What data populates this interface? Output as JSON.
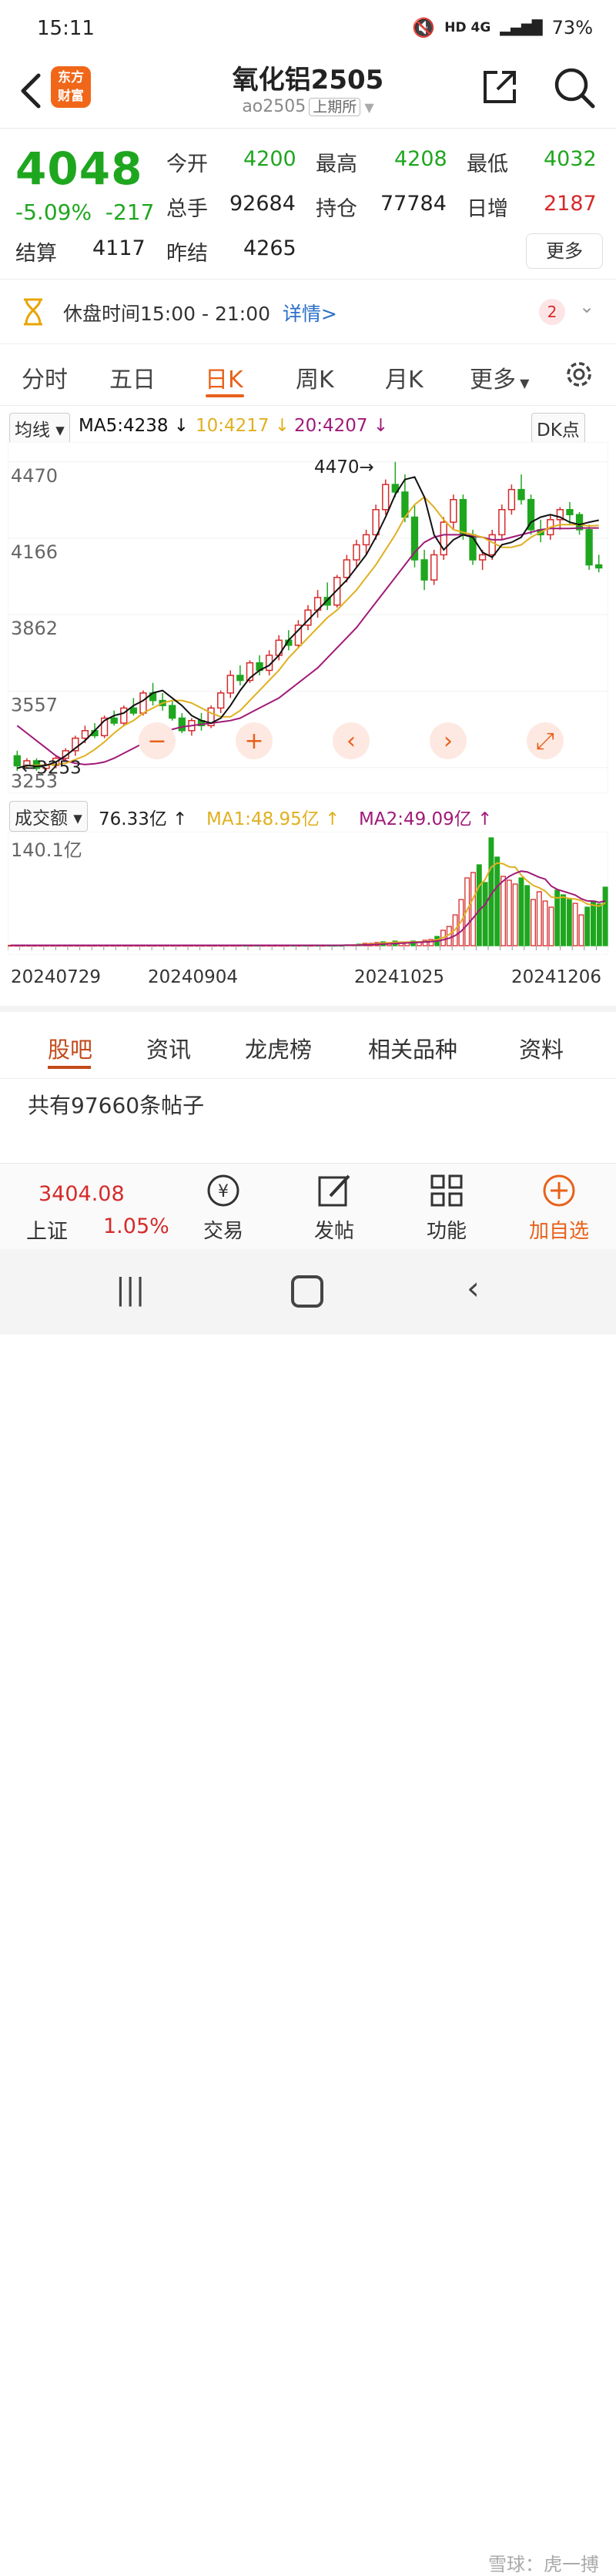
{
  "status": {
    "time": "15:11",
    "network": "HD 4G",
    "battery": "73%"
  },
  "header": {
    "logo_line1": "东方",
    "logo_line2": "财富",
    "title": "氧化铝2505",
    "code": "ao2505",
    "exchange": "上期所"
  },
  "quote": {
    "price": "4048",
    "change_pct": "-5.09%",
    "change": "-217",
    "open_label": "今开",
    "open": "4200",
    "high_label": "最高",
    "high": "4208",
    "low_label": "最低",
    "low": "4032",
    "volume_label": "总手",
    "volume": "92684",
    "oi_label": "持仓",
    "oi": "77784",
    "dayinc_label": "日增",
    "dayinc": "2187",
    "settle_label": "结算",
    "settle": "4117",
    "prev_settle_label": "昨结",
    "prev_settle": "4265",
    "more": "更多"
  },
  "notice": {
    "text": "休盘时间15:00 - 21:00",
    "detail": "详情>",
    "badge": "2"
  },
  "tabs": [
    "分时",
    "五日",
    "日K",
    "周K",
    "月K",
    "更多"
  ],
  "ma": {
    "selector": "均线",
    "ma5": "MA5:4238",
    "ma10": "10:4217",
    "ma20": "20:4207",
    "dk": "DK点"
  },
  "colors": {
    "up": "#d62a2a",
    "down": "#1fa61f",
    "accent": "#e8611a",
    "ma5": "#111111",
    "ma10": "#e0b020",
    "ma20": "#a01a78"
  },
  "chart_data": {
    "type": "candlestick",
    "y_ticks": [
      "4470",
      "4166",
      "3862",
      "3557",
      "3253"
    ],
    "ylim": [
      3200,
      4500
    ],
    "annotations": {
      "high": "4470",
      "low": "3253"
    },
    "ma5": [
      3250,
      3262,
      3258,
      3262,
      3275,
      3300,
      3330,
      3360,
      3400,
      3440,
      3460,
      3470,
      3500,
      3520,
      3550,
      3560,
      3530,
      3500,
      3460,
      3440,
      3430,
      3450,
      3500,
      3560,
      3610,
      3640,
      3660,
      3700,
      3760,
      3800,
      3840,
      3880,
      3920,
      3960,
      4000,
      4050,
      4100,
      4170,
      4250,
      4340,
      4400,
      4410,
      4330,
      4180,
      4120,
      4160,
      4180,
      4170,
      4110,
      4090,
      4140,
      4150,
      4170,
      4230,
      4250,
      4260,
      4250,
      4230,
      4220,
      4230,
      4238
    ],
    "ma10": [
      3250,
      3260,
      3262,
      3263,
      3265,
      3270,
      3285,
      3300,
      3325,
      3355,
      3390,
      3420,
      3440,
      3470,
      3490,
      3510,
      3520,
      3520,
      3510,
      3490,
      3470,
      3455,
      3455,
      3480,
      3520,
      3560,
      3600,
      3640,
      3690,
      3730,
      3770,
      3810,
      3850,
      3880,
      3920,
      3960,
      4010,
      4060,
      4120,
      4180,
      4250,
      4300,
      4330,
      4290,
      4240,
      4200,
      4190,
      4180,
      4170,
      4150,
      4130,
      4130,
      4140,
      4170,
      4190,
      4210,
      4220,
      4220,
      4220,
      4215,
      4217
    ],
    "ma20": [
      3420,
      3390,
      3360,
      3330,
      3300,
      3280,
      3270,
      3265,
      3268,
      3275,
      3290,
      3310,
      3330,
      3350,
      3370,
      3390,
      3405,
      3415,
      3420,
      3425,
      3430,
      3435,
      3440,
      3450,
      3470,
      3490,
      3510,
      3530,
      3560,
      3590,
      3620,
      3650,
      3690,
      3730,
      3770,
      3810,
      3860,
      3910,
      3960,
      4010,
      4060,
      4110,
      4150,
      4170,
      4180,
      4180,
      4180,
      4175,
      4170,
      4160,
      4160,
      4170,
      4180,
      4190,
      4200,
      4205,
      4205,
      4205,
      4207,
      4207,
      4207
    ],
    "candles": [
      [
        3300,
        3320,
        3240,
        3260
      ],
      [
        3260,
        3290,
        3250,
        3280
      ],
      [
        3280,
        3290,
        3240,
        3250
      ],
      [
        3250,
        3270,
        3240,
        3262
      ],
      [
        3262,
        3300,
        3250,
        3290
      ],
      [
        3290,
        3330,
        3280,
        3320
      ],
      [
        3320,
        3380,
        3300,
        3370
      ],
      [
        3370,
        3420,
        3350,
        3400
      ],
      [
        3400,
        3430,
        3370,
        3380
      ],
      [
        3380,
        3460,
        3370,
        3450
      ],
      [
        3450,
        3480,
        3420,
        3430
      ],
      [
        3430,
        3500,
        3420,
        3490
      ],
      [
        3490,
        3530,
        3460,
        3470
      ],
      [
        3470,
        3560,
        3460,
        3550
      ],
      [
        3550,
        3590,
        3500,
        3520
      ],
      [
        3520,
        3550,
        3480,
        3500
      ],
      [
        3500,
        3520,
        3440,
        3450
      ],
      [
        3450,
        3470,
        3390,
        3400
      ],
      [
        3400,
        3450,
        3380,
        3440
      ],
      [
        3440,
        3470,
        3400,
        3420
      ],
      [
        3420,
        3500,
        3410,
        3490
      ],
      [
        3490,
        3560,
        3470,
        3550
      ],
      [
        3550,
        3640,
        3530,
        3620
      ],
      [
        3620,
        3660,
        3580,
        3600
      ],
      [
        3600,
        3680,
        3590,
        3670
      ],
      [
        3670,
        3700,
        3620,
        3640
      ],
      [
        3640,
        3720,
        3620,
        3700
      ],
      [
        3700,
        3780,
        3680,
        3760
      ],
      [
        3760,
        3800,
        3720,
        3740
      ],
      [
        3740,
        3840,
        3730,
        3820
      ],
      [
        3820,
        3900,
        3800,
        3880
      ],
      [
        3880,
        3960,
        3850,
        3930
      ],
      [
        3930,
        3990,
        3880,
        3900
      ],
      [
        3900,
        4020,
        3890,
        4010
      ],
      [
        4010,
        4100,
        3990,
        4080
      ],
      [
        4080,
        4160,
        4050,
        4140
      ],
      [
        4140,
        4200,
        4100,
        4180
      ],
      [
        4180,
        4300,
        4160,
        4280
      ],
      [
        4280,
        4400,
        4260,
        4380
      ],
      [
        4380,
        4470,
        4330,
        4350
      ],
      [
        4350,
        4420,
        4230,
        4250
      ],
      [
        4250,
        4300,
        4050,
        4080
      ],
      [
        4080,
        4120,
        3960,
        4000
      ],
      [
        4000,
        4120,
        3980,
        4100
      ],
      [
        4100,
        4250,
        4080,
        4230
      ],
      [
        4230,
        4340,
        4200,
        4320
      ],
      [
        4320,
        4340,
        4160,
        4180
      ],
      [
        4180,
        4200,
        4060,
        4080
      ],
      [
        4080,
        4120,
        4040,
        4100
      ],
      [
        4100,
        4200,
        4080,
        4180
      ],
      [
        4180,
        4300,
        4160,
        4280
      ],
      [
        4280,
        4380,
        4260,
        4360
      ],
      [
        4360,
        4420,
        4300,
        4320
      ],
      [
        4320,
        4340,
        4180,
        4200
      ],
      [
        4200,
        4240,
        4150,
        4180
      ],
      [
        4180,
        4260,
        4160,
        4240
      ],
      [
        4240,
        4290,
        4200,
        4280
      ],
      [
        4280,
        4310,
        4220,
        4260
      ],
      [
        4260,
        4270,
        4180,
        4200
      ],
      [
        4200,
        4220,
        4040,
        4060
      ],
      [
        4060,
        4100,
        4030,
        4048
      ]
    ]
  },
  "vol": {
    "selector": "成交额",
    "val": "76.33亿",
    "ma1": "MA1:48.95亿",
    "ma2": "MA2:49.09亿",
    "max_label": "140.1亿",
    "values": [
      0.5,
      0.5,
      0.5,
      0.5,
      0.5,
      0.5,
      0.5,
      0.5,
      0.5,
      0.5,
      0.5,
      0.5,
      0.5,
      0.5,
      0.5,
      0.5,
      0.5,
      0.5,
      0.5,
      0.5,
      0.5,
      0.5,
      0.5,
      0.5,
      0.5,
      0.5,
      0.5,
      0.5,
      0.5,
      0.5,
      0.5,
      0.5,
      0.5,
      0.5,
      0.5,
      0.5,
      0.5,
      0.5,
      0.5,
      0.5,
      0.5,
      0.5,
      0.5,
      0.5,
      0.5,
      0.5,
      0.5,
      0.5,
      0.5,
      0.5,
      0.5,
      0.5,
      0.5,
      0.5,
      0.5,
      0.5,
      1,
      1,
      2,
      3,
      3,
      4,
      5,
      4,
      6,
      4,
      4,
      6,
      5,
      7,
      8,
      12,
      20,
      25,
      40,
      60,
      88,
      95,
      105,
      82,
      140,
      115,
      90,
      85,
      80,
      88,
      78,
      60,
      70,
      58,
      50,
      72,
      66,
      60,
      55,
      40,
      50,
      58,
      54,
      76
    ]
  },
  "dates": [
    "20240729",
    "20240904",
    "20241025",
    "20241206"
  ],
  "bottom_tabs": [
    "股吧",
    "资讯",
    "龙虎榜",
    "相关品种",
    "资料"
  ],
  "post_count": "共有97660条帖子",
  "footer": {
    "index_value": "3404.08",
    "index_name": "上证",
    "index_pct": "1.05%",
    "trade": "交易",
    "post": "发帖",
    "func": "功能",
    "add": "加自选"
  },
  "watermark": "雪球：虎一搏"
}
